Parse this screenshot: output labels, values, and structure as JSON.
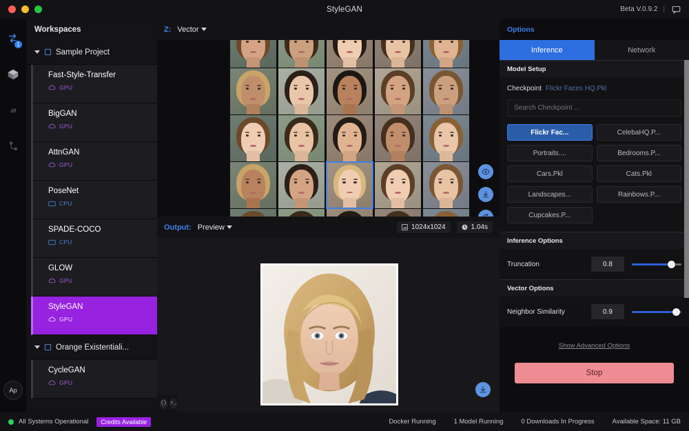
{
  "titlebar": {
    "title": "StyleGAN",
    "version": "Beta V.0.9.2",
    "separator": "|",
    "chat_icon": "chat-bubble-icon"
  },
  "rail": {
    "icons": [
      {
        "name": "transfer-icon",
        "badge": "1"
      },
      {
        "name": "cube-icon",
        "badge": ""
      },
      {
        "name": "link-icon",
        "badge": ""
      },
      {
        "name": "branch-icon",
        "badge": ""
      }
    ],
    "avatar": "Ap"
  },
  "sidebar": {
    "header": "Workspaces",
    "projects": [
      {
        "name": "Sample Project",
        "expanded": true,
        "models": [
          {
            "name": "Fast-Style-Transfer",
            "device": "GPU",
            "active": false
          },
          {
            "name": "BigGAN",
            "device": "GPU",
            "active": false
          },
          {
            "name": "AttnGAN",
            "device": "GPU",
            "active": false
          },
          {
            "name": "PoseNet",
            "device": "CPU",
            "active": false
          },
          {
            "name": "SPADE-COCO",
            "device": "CPU",
            "active": false
          },
          {
            "name": "GLOW",
            "device": "GPU",
            "active": false
          },
          {
            "name": "StyleGAN",
            "device": "GPU",
            "active": true
          }
        ]
      },
      {
        "name": "Orange Existentiali...",
        "expanded": true,
        "models": [
          {
            "name": "CycleGAN",
            "device": "GPU",
            "active": false
          }
        ]
      }
    ]
  },
  "center": {
    "z_label": "Z:",
    "z_value": "Vector",
    "output_label": "Output:",
    "output_value": "Preview",
    "resolution": "1024x1024",
    "duration": "1.04s",
    "resolution_icon": "image-size-icon",
    "duration_icon": "clock-icon",
    "side_buttons": [
      {
        "name": "compare-eye-icon"
      },
      {
        "name": "download-icon"
      },
      {
        "name": "refresh-icon"
      }
    ],
    "download_preview_icon": "download-icon",
    "code_buttons": [
      {
        "name": "code-braces-icon",
        "label": "{}"
      },
      {
        "name": "terminal-icon",
        "label": ">_"
      }
    ],
    "grid_selected_index": 17
  },
  "options": {
    "title": "Options",
    "tabs": [
      {
        "label": "Inference",
        "active": true
      },
      {
        "label": "Network",
        "active": false
      }
    ],
    "model_setup": {
      "heading": "Model Setup",
      "checkpoint_label": "Checkpoint",
      "checkpoint_value": "Flickr Faces HQ.Pkl",
      "search_placeholder": "Search Checkpoint ...",
      "search_value": "",
      "checkpoints": [
        {
          "label": "Flickr Fac...",
          "selected": true
        },
        {
          "label": "CelebaHQ.P...",
          "selected": false
        },
        {
          "label": "Portraits....",
          "selected": false
        },
        {
          "label": "Bedrooms.P...",
          "selected": false
        },
        {
          "label": "Cars.Pkl",
          "selected": false
        },
        {
          "label": "Cats.Pkl",
          "selected": false
        },
        {
          "label": "Landscapes...",
          "selected": false
        },
        {
          "label": "Rainbows.P...",
          "selected": false
        },
        {
          "label": "Cupcakes.P...",
          "selected": false
        }
      ]
    },
    "inference_options": {
      "heading": "Inference Options",
      "truncation_label": "Truncation",
      "truncation_value": "0.8",
      "truncation_percent": 80
    },
    "vector_options": {
      "heading": "Vector Options",
      "neighbor_label": "Neighbor Similarity",
      "neighbor_value": "0.9",
      "neighbor_percent": 90
    },
    "advanced_link": "Show Advanced Options",
    "stop_button": "Stop"
  },
  "statusbar": {
    "system_status": "All Systems Operational",
    "credits": "Credits Available",
    "docker": "Docker Running",
    "models_running": "1 Model Running",
    "downloads": "0 Downloads In Progress",
    "space": "Available Space: 11 GB"
  },
  "colors": {
    "accent_blue": "#2d6fe0",
    "accent_purple": "#9722e0",
    "stop_red": "#ef8c93",
    "status_green": "#2fcf5e"
  }
}
